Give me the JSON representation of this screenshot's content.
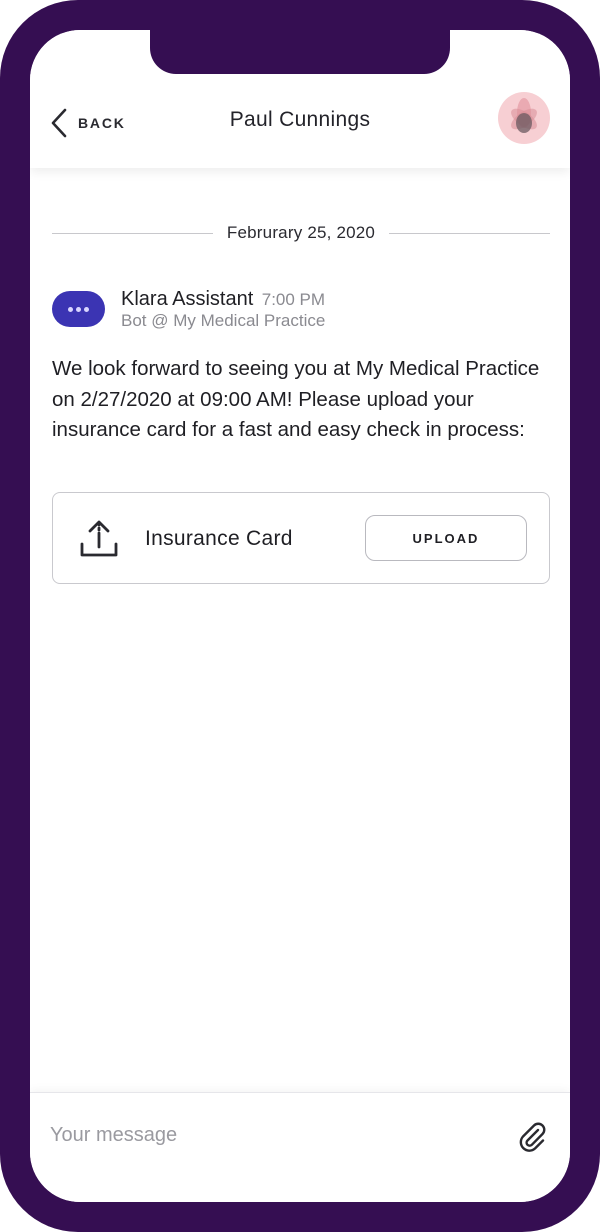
{
  "header": {
    "back_label": "BACK",
    "title": "Paul Cunnings"
  },
  "thread": {
    "date_divider": "Februrary 25, 2020",
    "message": {
      "sender": "Klara Assistant",
      "time": "7:00 PM",
      "subtitle": "Bot @ My Medical Practice",
      "body": "We look forward to seeing you at My Medical Practice on 2/27/2020 at 09:00 AM! Please upload your insurance card for a fast and easy check in process:"
    },
    "attachment_card": {
      "label": "Insurance Card",
      "button_label": "UPLOAD",
      "icon": "upload-icon"
    }
  },
  "composer": {
    "placeholder": "Your message",
    "attach_icon": "paperclip-icon"
  },
  "colors": {
    "device_frame": "#350e52",
    "bot_badge": "#3b34b3",
    "avatar_bg": "#f7cfd3"
  }
}
